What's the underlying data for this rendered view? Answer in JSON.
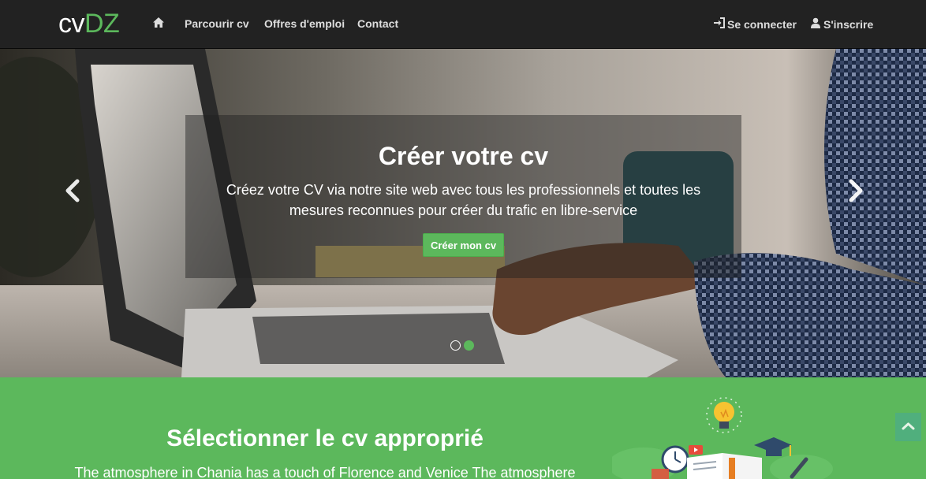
{
  "brand": {
    "part1": "cv",
    "part2": "DZ"
  },
  "nav": {
    "home_icon": "home-icon",
    "items": [
      {
        "label": "Parcourir cv"
      },
      {
        "label": "Offres d'emploi"
      },
      {
        "label": "Contact"
      }
    ],
    "login": {
      "label": "Se connecter",
      "icon": "login-icon"
    },
    "signup": {
      "label": "S'inscrire",
      "icon": "user-icon"
    }
  },
  "hero": {
    "title": "Créer votre cv",
    "text": "Créez votre CV via notre site web avec tous les professionnels et toutes les mesures reconnues pour créer du trafic en libre-service",
    "button": "Créer mon cv",
    "prev_icon": "chevron-left-icon",
    "next_icon": "chevron-right-icon",
    "slides_total": 2,
    "active_slide": 2
  },
  "section": {
    "title": "Sélectionner le cv approprié",
    "text": "The atmosphere in Chania has a touch of Florence and Venice The atmosphere",
    "illustration": "education-illustration",
    "scroll_top_icon": "chevron-up-icon"
  },
  "colors": {
    "accent": "#5cb85c",
    "navbar": "#222222"
  }
}
